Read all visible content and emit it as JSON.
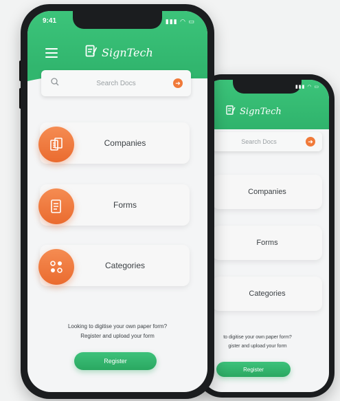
{
  "status": {
    "time": "9:41",
    "icons": "▮▮▮ ◠ ▭"
  },
  "brand": {
    "name": "SignTech"
  },
  "search": {
    "placeholder": "Search Docs",
    "go_icon": "arrow-right-icon"
  },
  "menu": {
    "items": [
      {
        "label": "Companies",
        "icon": "building-documents-icon"
      },
      {
        "label": "Forms",
        "icon": "document-icon"
      },
      {
        "label": "Categories",
        "icon": "grid-dots-icon"
      }
    ]
  },
  "footer": {
    "line1": "Looking to digitise your own paper form?",
    "line2": "Register and upload your form",
    "register_label": "Register"
  },
  "back_footer": {
    "line1": "to digitise your own paper form?",
    "line2": "gister and upload your form"
  },
  "colors": {
    "green": "#3cc47a",
    "orange": "#ea6b2f",
    "background": "#f2f3f3"
  }
}
